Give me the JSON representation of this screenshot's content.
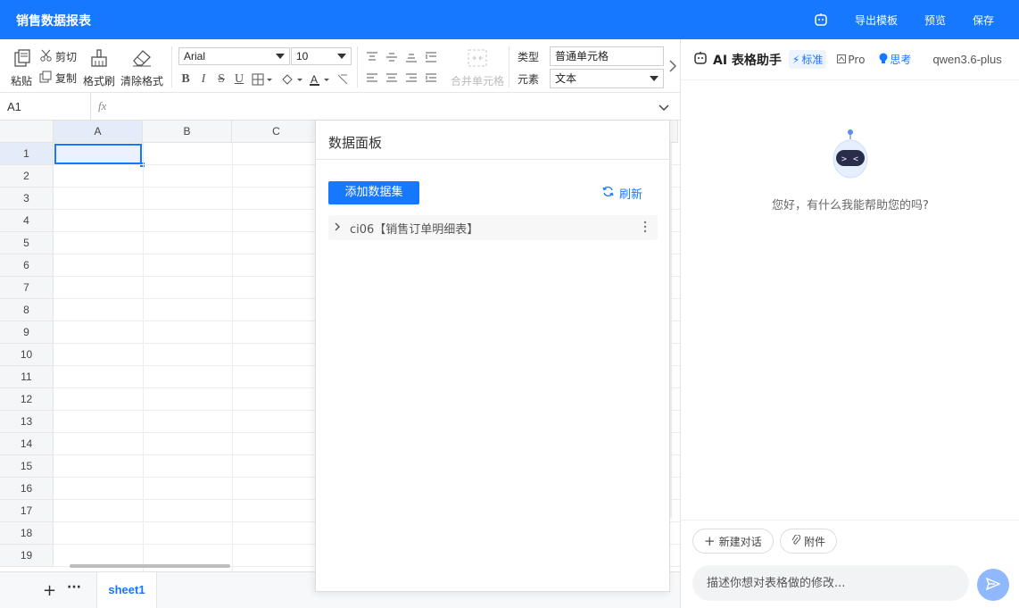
{
  "app": {
    "title": "销售数据报表"
  },
  "header": {
    "export_label": "导出模板",
    "preview_label": "预览",
    "save_label": "保存"
  },
  "toolbar": {
    "paste": "粘贴",
    "cut": "剪切",
    "copy": "复制",
    "format_painter": "格式刷",
    "clear_format": "清除格式",
    "font_family": "Arial",
    "font_size": "10",
    "merge_cells": "合并单元格",
    "type_label": "类型",
    "type_value": "普通单元格",
    "element_label": "元素",
    "element_value": "文本"
  },
  "formula_bar": {
    "cell_ref": "A1",
    "fx": "fx"
  },
  "grid": {
    "columns": [
      "A",
      "B",
      "C"
    ],
    "rows": [
      "1",
      "2",
      "3",
      "4",
      "5",
      "6",
      "7",
      "8",
      "9",
      "10",
      "11",
      "12",
      "13",
      "14",
      "15",
      "16",
      "17",
      "18",
      "19"
    ],
    "selected_cell": "A1"
  },
  "sheets": {
    "active": "sheet1"
  },
  "data_panel": {
    "title": "数据面板",
    "add_dataset": "添加数据集",
    "refresh": "刷新",
    "datasets": [
      {
        "name": "ci06【销售订单明细表】"
      }
    ]
  },
  "ai_panel": {
    "title": "AI 表格助手",
    "mode_standard": "标准",
    "mode_pro": "Pro",
    "mode_think": "思考",
    "model": "qwen3.6-plus",
    "greeting": "您好，有什么我能帮助您的吗?",
    "new_chat": "新建对话",
    "attachment": "附件",
    "input_placeholder": "描述你想对表格做的修改..."
  },
  "colors": {
    "primary": "#1677ff",
    "send_button": "#8fb8ff"
  }
}
